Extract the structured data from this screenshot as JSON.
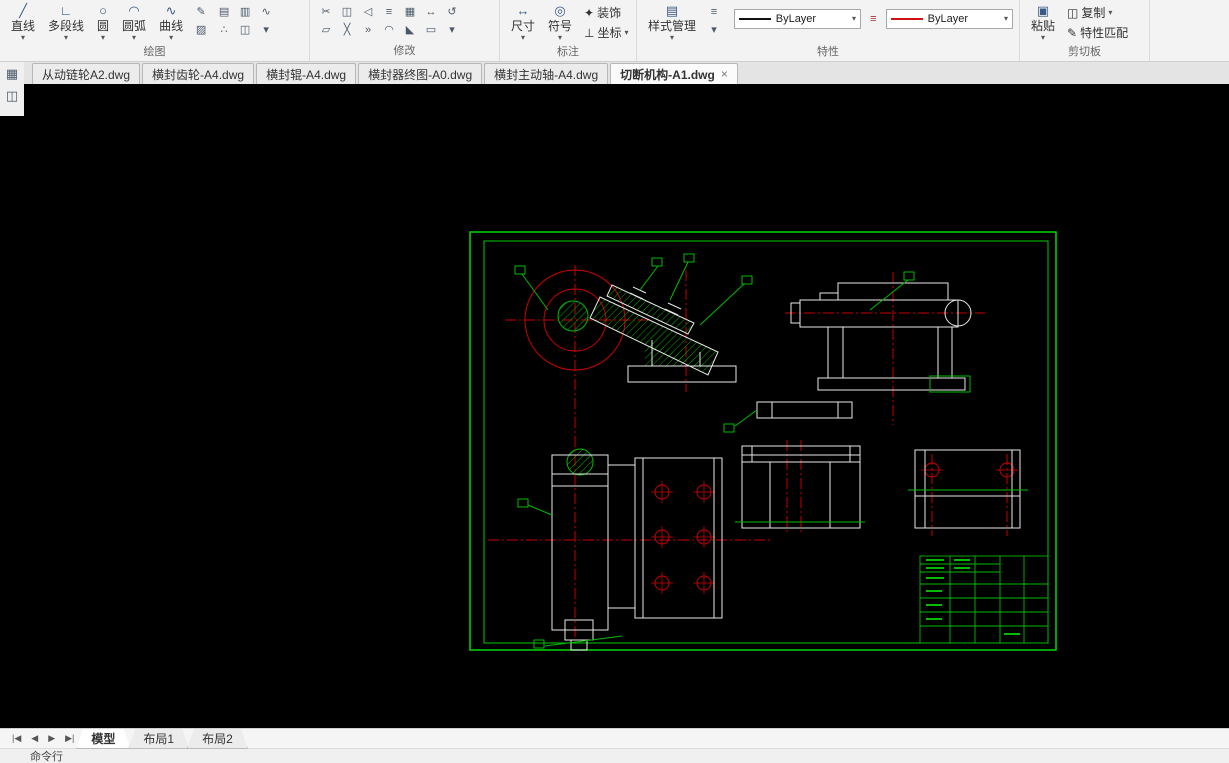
{
  "ribbon": {
    "draw": {
      "label": "绘图",
      "line": "直线",
      "polyline": "多段线",
      "circle": "圆",
      "arc": "圆弧",
      "curve": "曲线"
    },
    "modify": {
      "label": "修改"
    },
    "annotate": {
      "label": "标注",
      "dimension": "尺寸",
      "symbol": "符号",
      "decor": "装饰",
      "coordinate": "坐标"
    },
    "properties": {
      "label": "特性",
      "style_manager": "样式管理",
      "linetype_value": "ByLayer",
      "color_value": "ByLayer"
    },
    "clipboard": {
      "label": "剪切板",
      "paste": "粘贴",
      "copy": "复制",
      "match": "特性匹配"
    }
  },
  "file_tabs": [
    {
      "label": "从动链轮A2.dwg",
      "active": false
    },
    {
      "label": "横封齿轮-A4.dwg",
      "active": false
    },
    {
      "label": "横封辊-A4.dwg",
      "active": false
    },
    {
      "label": "横封器终图-A0.dwg",
      "active": false
    },
    {
      "label": "横封主动轴-A4.dwg",
      "active": false
    },
    {
      "label": "切断机构-A1.dwg",
      "active": true
    }
  ],
  "layout_bar": {
    "model": "模型",
    "layout1": "布局1",
    "layout2": "布局2"
  },
  "command_bar": {
    "text": "命令行"
  },
  "colors": {
    "drawing_green": "#00bb00",
    "centerline_red": "#cc0000",
    "frame_green": "#00cc00",
    "line_white": "#e8e8e8",
    "canvas_bg": "#000000"
  },
  "icons": {
    "caret": "▾",
    "close": "×",
    "line": "╱",
    "polyline": "∟",
    "circle": "○",
    "arc": "◠",
    "curve": "∿",
    "pencil": "✎",
    "hatch": "▨",
    "region": "▤",
    "gradient": "▥",
    "spline": "∿",
    "point": "∴",
    "erase": "✂",
    "copy": "◫",
    "mirror": "◁",
    "offset": "≡",
    "array": "▦",
    "move": "↔",
    "rotate": "↺",
    "scale": "▱",
    "trim": "╳",
    "extend": "»",
    "fillet": "◠",
    "chamfer": "◣",
    "explode": "▭",
    "dimension": "↔",
    "symbol": "◎",
    "decor": "✦",
    "coordinate": "⊥",
    "style": "▤",
    "props": "≡",
    "paste": "▣",
    "match": "✎",
    "nav_first": "|◀",
    "nav_prev": "◀",
    "nav_next": "▶",
    "nav_last": "▶|",
    "panel_a": "▦",
    "panel_b": "◫"
  }
}
